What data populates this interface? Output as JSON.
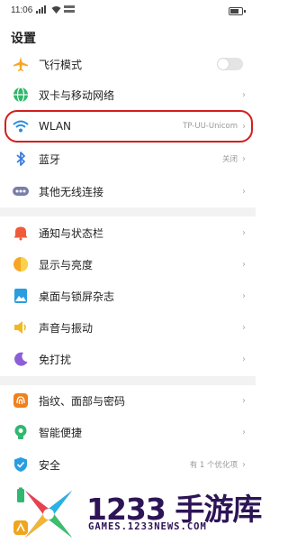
{
  "status_bar": {
    "time": "11:06"
  },
  "page": {
    "title": "设置"
  },
  "section1": [
    {
      "label": "飞行模式",
      "icon": "airplane-icon",
      "color": "#f6a623"
    },
    {
      "label": "双卡与移动网络",
      "icon": "globe-icon",
      "color": "#2fb86a"
    },
    {
      "label": "WLAN",
      "value": "TP-UU-Unicom",
      "icon": "wifi-icon",
      "color": "#2a8de0"
    },
    {
      "label": "蓝牙",
      "value": "关闭",
      "icon": "bluetooth-icon",
      "color": "#3a7de0"
    },
    {
      "label": "其他无线连接",
      "icon": "more-dots-icon",
      "color": "#7a7fa8"
    }
  ],
  "section2": [
    {
      "label": "通知与状态栏",
      "icon": "bell-icon",
      "color": "#f05a3a"
    },
    {
      "label": "显示与亮度",
      "icon": "brightness-icon",
      "color": "#f6a623"
    },
    {
      "label": "桌面与锁屏杂志",
      "icon": "picture-icon",
      "color": "#2a9de0"
    },
    {
      "label": "声音与振动",
      "icon": "speaker-icon",
      "color": "#f0b823"
    },
    {
      "label": "免打扰",
      "icon": "moon-icon",
      "color": "#8b5fd8"
    }
  ],
  "section3": [
    {
      "label": "指纹、面部与密码",
      "icon": "fingerprint-icon",
      "color": "#f0801e"
    },
    {
      "label": "智能便捷",
      "icon": "smart-icon",
      "color": "#30b870"
    },
    {
      "label": "安全",
      "value": "有 1 个优化项",
      "icon": "shield-icon",
      "color": "#2a9de0"
    }
  ],
  "watermark": {
    "brand": "1233 手游库",
    "url": "GAMES.1233NEWS.COM"
  }
}
